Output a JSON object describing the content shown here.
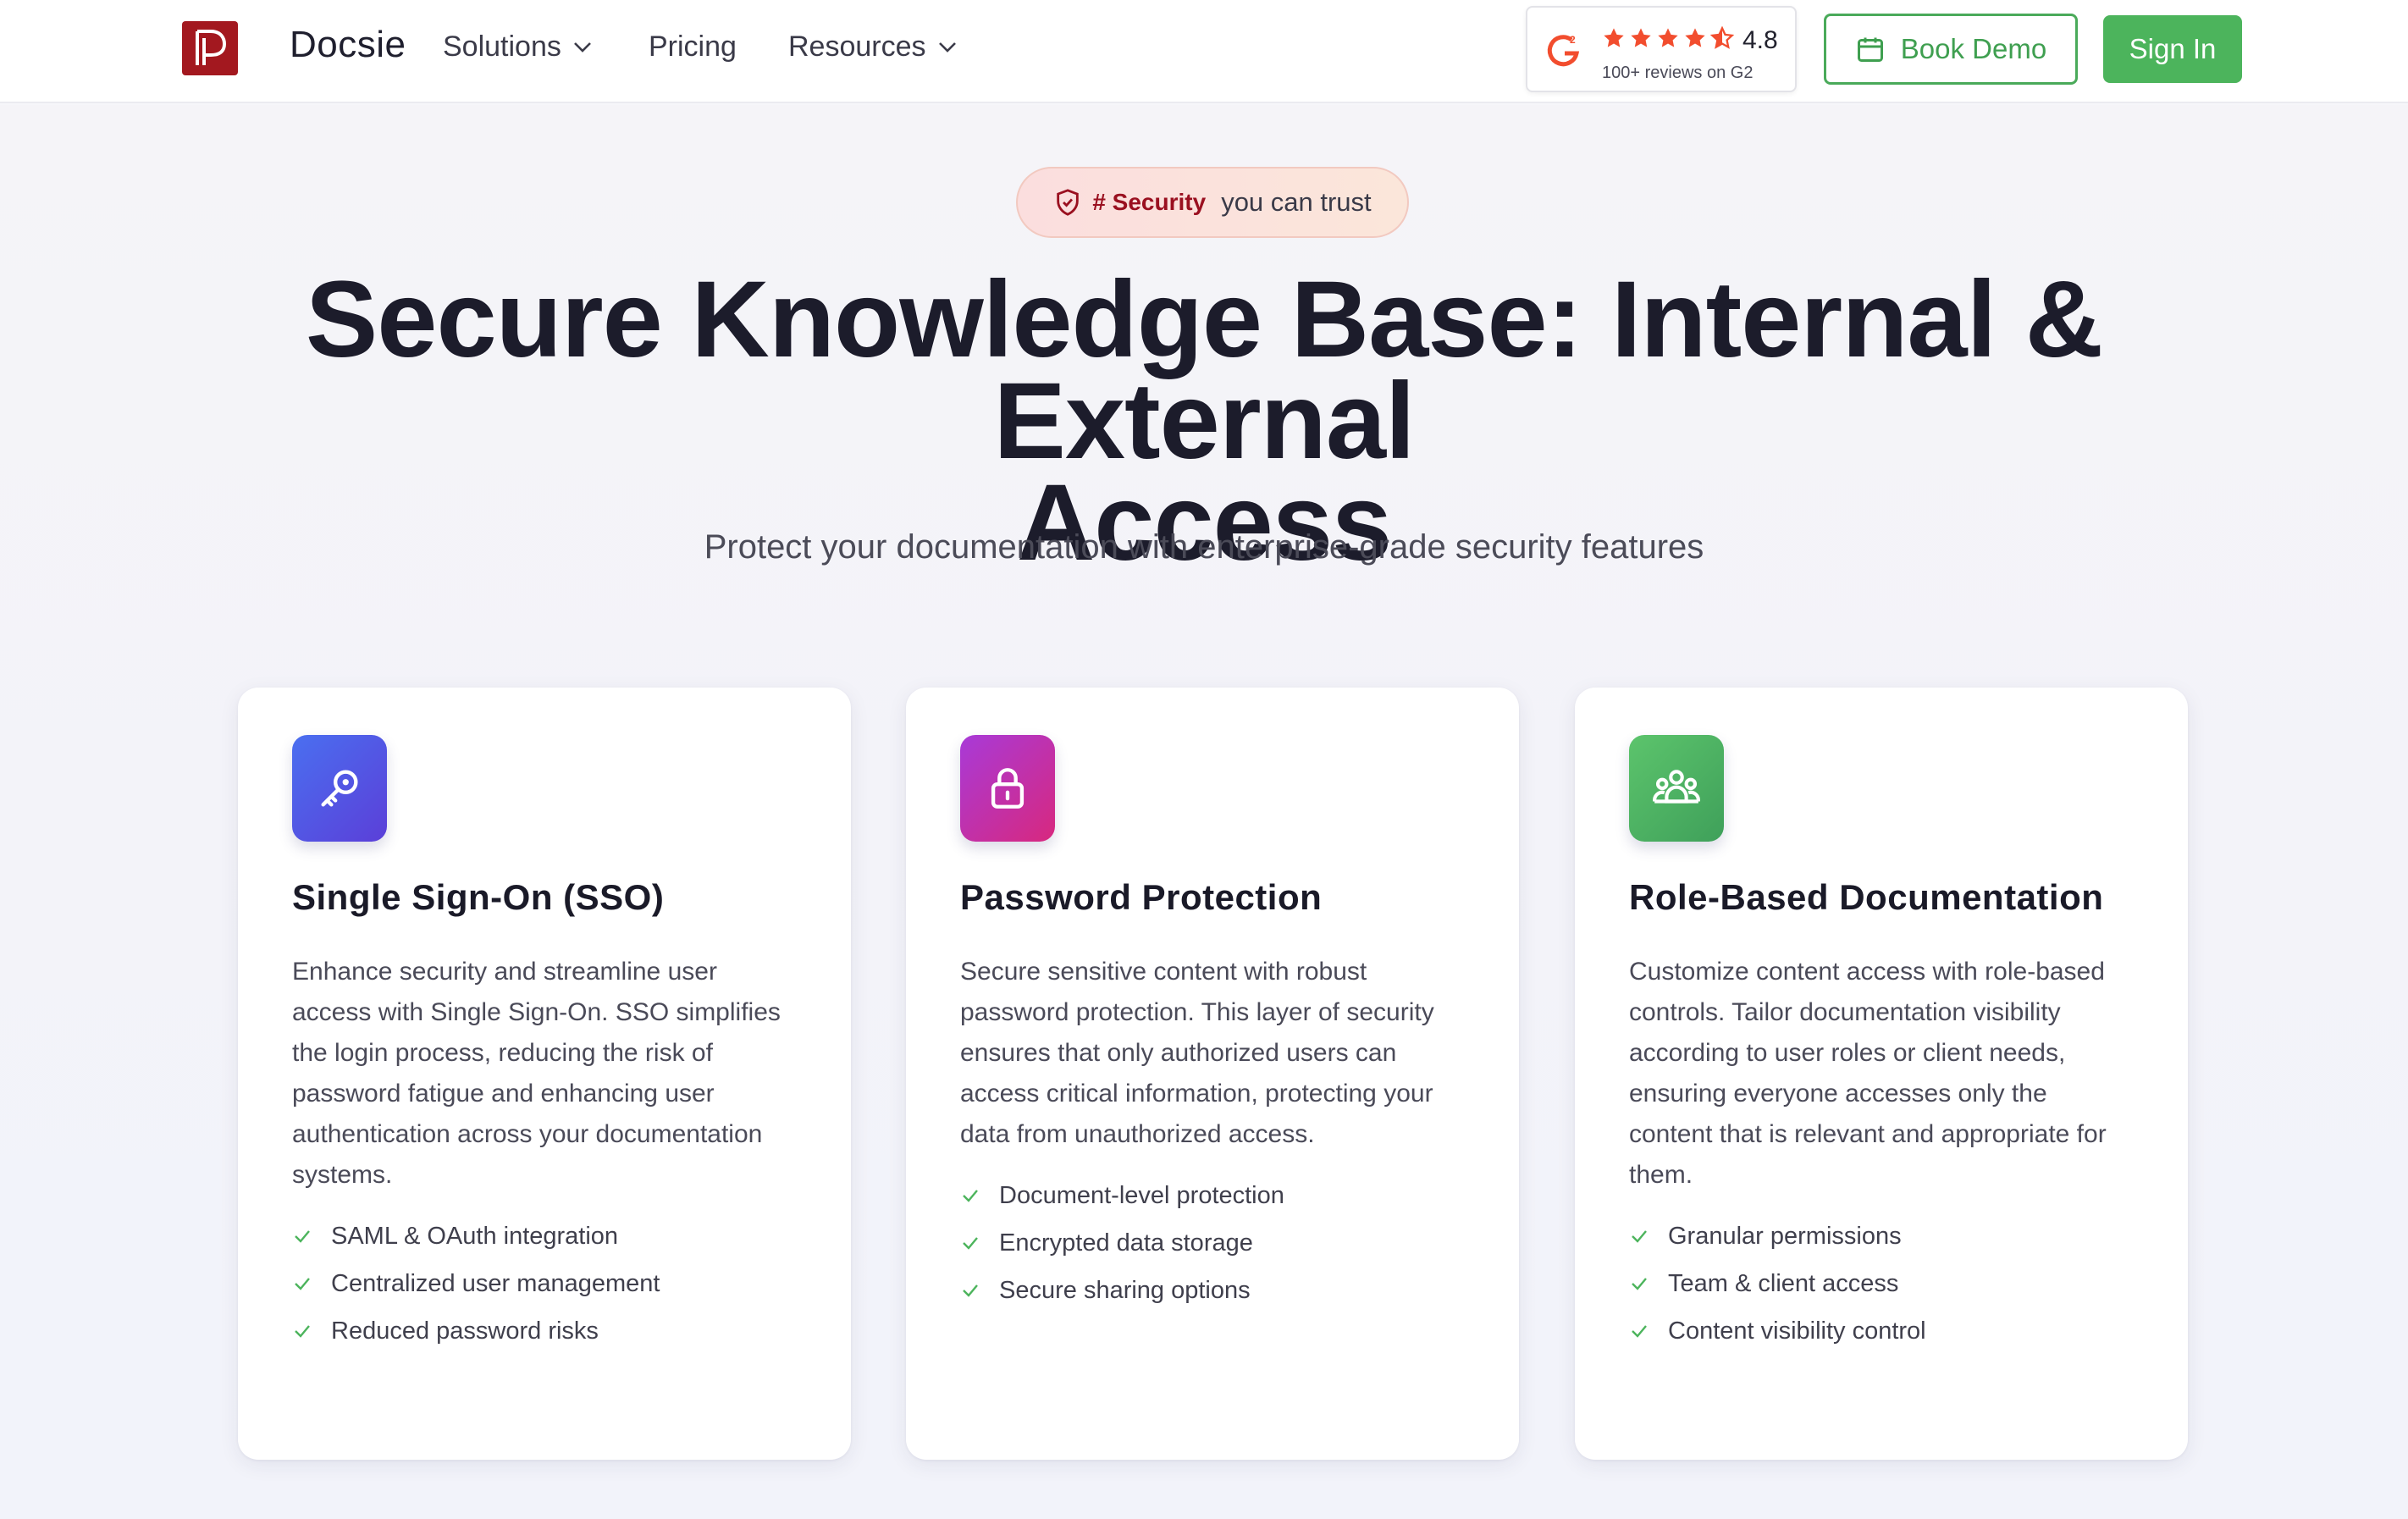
{
  "nav": {
    "brand": "Docsie",
    "items": [
      {
        "label": "Solutions",
        "dropdown": true
      },
      {
        "label": "Pricing",
        "dropdown": false
      },
      {
        "label": "Resources",
        "dropdown": true
      }
    ],
    "g2": {
      "score": "4.8",
      "reviews": "100+ reviews on G2",
      "stars": 4.5
    },
    "book_demo": "Book Demo",
    "sign_in": "Sign In"
  },
  "hero": {
    "pill_tag": "# Security",
    "pill_text": "you can trust",
    "title_line1": "Secure Knowledge Base: Internal & External",
    "title_line2": "Access",
    "subtitle": "Protect your documentation with enterprise-grade security features"
  },
  "cards": [
    {
      "icon": "key-icon",
      "title": "Single Sign-On (SSO)",
      "description": "Enhance security and streamline user access with Single Sign-On. SSO simplifies the login process, reducing the risk of password fatigue and enhancing user authentication across your documentation systems.",
      "features": [
        "SAML & OAuth integration",
        "Centralized user management",
        "Reduced password risks"
      ]
    },
    {
      "icon": "lock-icon",
      "title": "Password Protection",
      "description": "Secure sensitive content with robust password protection. This layer of security ensures that only authorized users can access critical information, protecting your data from unauthorized access.",
      "features": [
        "Document-level protection",
        "Encrypted data storage",
        "Secure sharing options"
      ]
    },
    {
      "icon": "users-icon",
      "title": "Role-Based Documentation",
      "description": "Customize content access with role-based controls. Tailor documentation visibility according to user roles or client needs, ensuring everyone accesses only the content that is relevant and appropriate for them.",
      "features": [
        "Granular permissions",
        "Team & client access",
        "Content visibility control"
      ]
    }
  ],
  "colors": {
    "accent_green": "#4cb45c",
    "brand_red": "#a3181f",
    "sso_gradient": [
      "#4a6ff0",
      "#5b3fd8"
    ],
    "password_gradient": [
      "#a83ad8",
      "#d8287e"
    ],
    "role_gradient": [
      "#5cc46c",
      "#3fa05a"
    ]
  }
}
